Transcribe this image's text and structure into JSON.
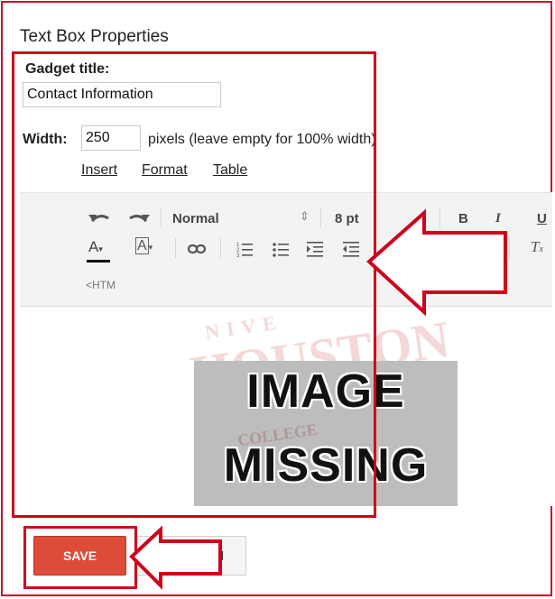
{
  "dialog": {
    "title": "Text Box Properties",
    "gadget_title_label": "Gadget title:",
    "gadget_title_value": "Contact Information",
    "width_label": "Width:",
    "width_value": "250",
    "width_hint": "pixels  (leave empty for 100% width)"
  },
  "menu": {
    "insert": "Insert",
    "format": "Format",
    "table": "Table"
  },
  "toolbar": {
    "paragraph_style": "Normal",
    "font_size": "8 pt",
    "bold": "B",
    "italic": "I",
    "underline": "U",
    "html_toggle": "<HTM"
  },
  "editor": {
    "image_line1": "IMAGE",
    "image_line2": "MISSING",
    "watermark_top": "NIVE",
    "watermark_main": "HOUSTON",
    "watermark_sub": "COLLEGE"
  },
  "buttons": {
    "save": "SAVE",
    "cancel": "ncel"
  },
  "colors": {
    "annotation_red": "#d0021b",
    "save_red": "#dd4b39"
  }
}
